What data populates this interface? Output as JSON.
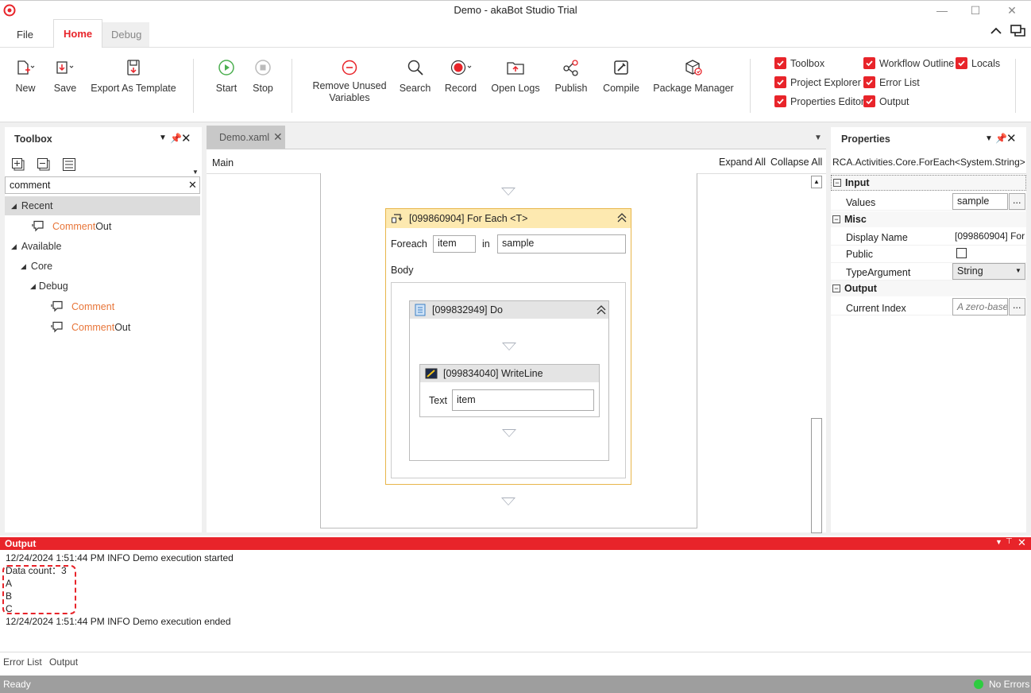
{
  "window": {
    "title": "Demo - akaBot Studio Trial"
  },
  "ribbon_tabs": [
    {
      "label": "File"
    },
    {
      "label": "Home"
    },
    {
      "label": "Debug"
    }
  ],
  "ribbon": {
    "new": "New",
    "save": "Save",
    "export": "Export As Template",
    "start": "Start",
    "stop": "Stop",
    "remove_unused_line1": "Remove Unused",
    "remove_unused_line2": "Variables",
    "search": "Search",
    "record": "Record",
    "open_logs": "Open Logs",
    "publish": "Publish",
    "compile": "Compile",
    "package_manager": "Package Manager",
    "checks": {
      "toolbox": "Toolbox",
      "project_explorer": "Project Explorer",
      "properties_editor": "Properties Editor",
      "workflow_outline": "Workflow Outline",
      "error_list": "Error List",
      "output": "Output",
      "locals": "Locals"
    }
  },
  "toolbox": {
    "title": "Toolbox",
    "search_value": "comment",
    "recent": "Recent",
    "recent_item_a": "Comment",
    "recent_item_b": " Out",
    "available": "Available",
    "core": "Core",
    "debug": "Debug",
    "item1": "Comment",
    "item2a": "Comment",
    "item2b": " Out"
  },
  "designer": {
    "tab": "Demo.xaml",
    "breadcrumb": "Main",
    "expand_all": "Expand All",
    "collapse_all": "Collapse All",
    "foreach_title": "[099860904] For Each <T>",
    "foreach_label": "Foreach",
    "foreach_var": "item",
    "in_label": "in",
    "foreach_values": "sample",
    "body_label": "Body",
    "do_title": "[099832949] Do",
    "writeline_title": "[099834040] WriteLine",
    "text_label": "Text",
    "text_value": "item"
  },
  "properties": {
    "title": "Properties",
    "type": "RCA.Activities.Core.ForEach<System.String>",
    "sec_input": "Input",
    "values_label": "Values",
    "values_value": "sample",
    "sec_misc": "Misc",
    "display_name_label": "Display Name",
    "display_name_value": "[099860904] For",
    "public_label": "Public",
    "typearg_label": "TypeArgument",
    "typearg_value": "String",
    "sec_output": "Output",
    "current_index_label": "Current Index",
    "current_index_placeholder": "A zero-base",
    "ellipsis": "..."
  },
  "output": {
    "title": "Output",
    "lines": [
      "12/24/2024 1:51:44 PM INFO Demo execution started",
      "Data count：3",
      "A",
      "B",
      "C",
      "12/24/2024 1:51:44 PM INFO Demo execution ended"
    ]
  },
  "bottom_tabs": [
    "Error List",
    "Output"
  ],
  "status": {
    "left": "Ready",
    "right": "No Errors"
  },
  "colors": {
    "accent": "#e8242a",
    "foreach_header": "#fde9b0",
    "activity_header": "#e4e4e4",
    "status_bar": "#9e9e9e",
    "ok": "#2ecc40"
  }
}
